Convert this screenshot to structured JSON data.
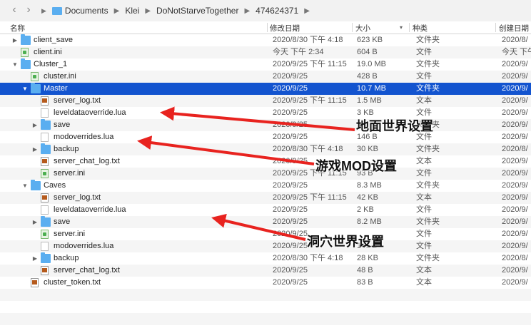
{
  "path": [
    "Documents",
    "Klei",
    "DoNotStarveTogether",
    "474624371"
  ],
  "columns": {
    "name": "名称",
    "date": "修改日期",
    "size": "大小",
    "kind": "种类",
    "created": "创建日期"
  },
  "rows": [
    {
      "name": "client_save",
      "date": "2020/8/30 下午 4:18",
      "size": "623 KB",
      "kind": "文件夹",
      "created": "2020/8/",
      "icon": "folder-icon",
      "indent": 0,
      "tri": "right"
    },
    {
      "name": "client.ini",
      "date": "今天 下午 2:34",
      "size": "604 B",
      "kind": "文件",
      "created": "今天 下午",
      "icon": "ini-file-icon",
      "indent": 0,
      "tri": ""
    },
    {
      "name": "Cluster_1",
      "date": "2020/9/25 下午 11:15",
      "size": "19.0 MB",
      "kind": "文件夹",
      "created": "2020/9/",
      "icon": "folder-icon",
      "indent": 0,
      "tri": "down"
    },
    {
      "name": "cluster.ini",
      "date": "2020/9/25",
      "size": "428 B",
      "kind": "文件",
      "created": "2020/9/",
      "icon": "ini-file-icon",
      "indent": 1,
      "tri": ""
    },
    {
      "name": "Master",
      "date": "2020/9/25",
      "size": "10.7 MB",
      "kind": "文件夹",
      "created": "2020/9/",
      "icon": "folder-icon",
      "indent": 1,
      "tri": "down",
      "selected": true
    },
    {
      "name": "server_log.txt",
      "date": "2020/9/25 下午 11:15",
      "size": "1.5 MB",
      "kind": "文本",
      "created": "2020/9/",
      "icon": "log-file-icon",
      "indent": 2,
      "tri": ""
    },
    {
      "name": "leveldataoverride.lua",
      "date": "2020/9/25",
      "size": "3 KB",
      "kind": "文件",
      "created": "2020/9/",
      "icon": "document-icon",
      "indent": 2,
      "tri": ""
    },
    {
      "name": "save",
      "date": "2020/9/25",
      "size": "",
      "kind": "文件夹",
      "created": "2020/9/",
      "icon": "folder-icon",
      "indent": 2,
      "tri": "right"
    },
    {
      "name": "modoverrides.lua",
      "date": "2020/9/25",
      "size": "146 B",
      "kind": "文件",
      "created": "2020/9/",
      "icon": "document-icon",
      "indent": 2,
      "tri": ""
    },
    {
      "name": "backup",
      "date": "2020/8/30 下午 4:18",
      "size": "30 KB",
      "kind": "文件夹",
      "created": "2020/8/",
      "icon": "folder-icon",
      "indent": 2,
      "tri": "right"
    },
    {
      "name": "server_chat_log.txt",
      "date": "2020/9/25",
      "size": "",
      "kind": "文本",
      "created": "2020/9/",
      "icon": "log-file-icon",
      "indent": 2,
      "tri": ""
    },
    {
      "name": "server.ini",
      "date": "2020/9/25 下午 11:15",
      "size": "93 B",
      "kind": "文件",
      "created": "2020/9/",
      "icon": "ini-file-icon",
      "indent": 2,
      "tri": ""
    },
    {
      "name": "Caves",
      "date": "2020/9/25",
      "size": "8.3 MB",
      "kind": "文件夹",
      "created": "2020/9/",
      "icon": "folder-icon",
      "indent": 1,
      "tri": "down"
    },
    {
      "name": "server_log.txt",
      "date": "2020/9/25 下午 11:15",
      "size": "42 KB",
      "kind": "文本",
      "created": "2020/9/",
      "icon": "log-file-icon",
      "indent": 2,
      "tri": ""
    },
    {
      "name": "leveldataoverride.lua",
      "date": "2020/9/25",
      "size": "2 KB",
      "kind": "文件",
      "created": "2020/9/",
      "icon": "document-icon",
      "indent": 2,
      "tri": ""
    },
    {
      "name": "save",
      "date": "2020/9/25",
      "size": "8.2 MB",
      "kind": "文件夹",
      "created": "2020/9/",
      "icon": "folder-icon",
      "indent": 2,
      "tri": "right"
    },
    {
      "name": "server.ini",
      "date": "2020/9/25",
      "size": "",
      "kind": "文件",
      "created": "2020/9/",
      "icon": "ini-file-icon",
      "indent": 2,
      "tri": ""
    },
    {
      "name": "modoverrides.lua",
      "date": "2020/9/25",
      "size": "146 B",
      "kind": "文件",
      "created": "2020/9/",
      "icon": "document-icon",
      "indent": 2,
      "tri": ""
    },
    {
      "name": "backup",
      "date": "2020/8/30 下午 4:18",
      "size": "28 KB",
      "kind": "文件夹",
      "created": "2020/8/",
      "icon": "folder-icon",
      "indent": 2,
      "tri": "right"
    },
    {
      "name": "server_chat_log.txt",
      "date": "2020/9/25",
      "size": "48 B",
      "kind": "文本",
      "created": "2020/9/",
      "icon": "log-file-icon",
      "indent": 2,
      "tri": ""
    },
    {
      "name": "cluster_token.txt",
      "date": "2020/9/25",
      "size": "83 B",
      "kind": "文本",
      "created": "2020/9/",
      "icon": "log-file-icon",
      "indent": 1,
      "tri": ""
    }
  ],
  "annotations": {
    "surface": "地面世界设置",
    "mod": "游戏MOD设置",
    "caves": "洞穴世界设置"
  },
  "colors": {
    "arrow": "#e8231f",
    "selection": "#1354cf",
    "folder": "#5aaef0"
  }
}
